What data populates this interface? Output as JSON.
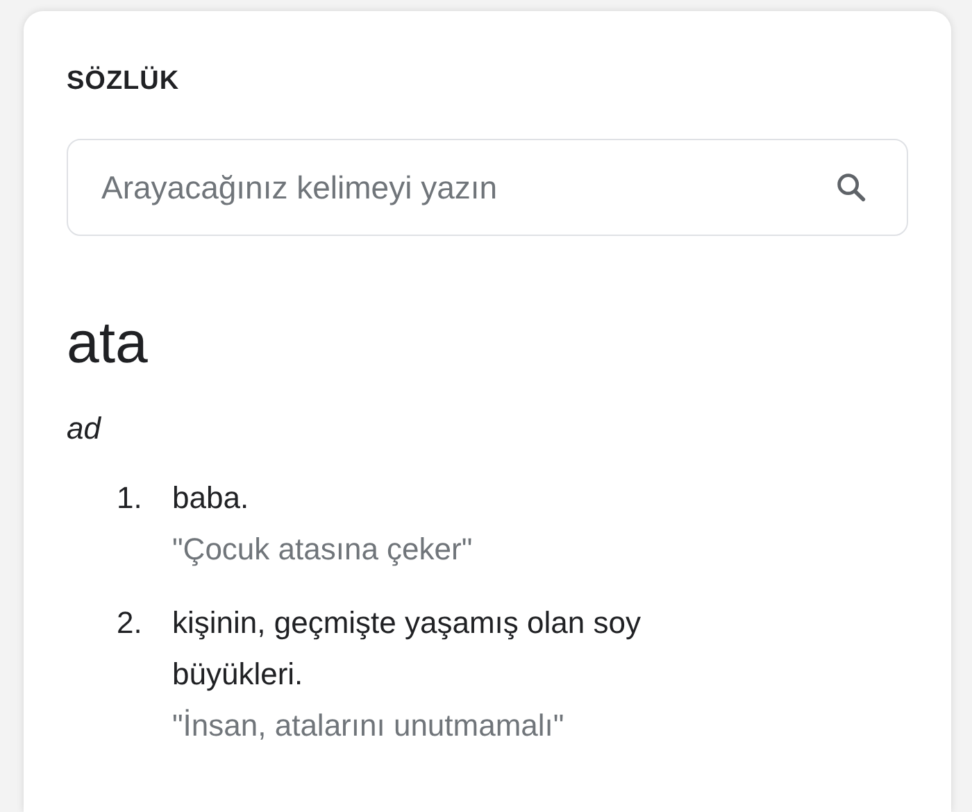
{
  "card_title": "SÖZLÜK",
  "search": {
    "placeholder": "Arayacağınız kelimeyi yazın"
  },
  "word": "ata",
  "part_of_speech": "ad",
  "definitions": [
    {
      "number": "1.",
      "text": "baba.",
      "example": "\"Çocuk atasına çeker\""
    },
    {
      "number": "2.",
      "text": "kişinin, geçmişte yaşamış olan soy büyükleri.",
      "example": "\"İnsan, atalarını unutmamalı\""
    }
  ]
}
